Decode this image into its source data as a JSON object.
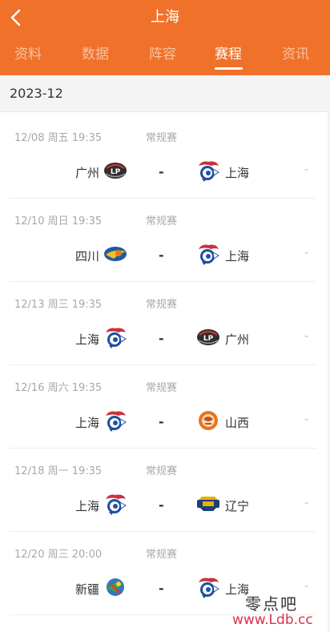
{
  "header": {
    "title": "上海",
    "back_icon": "chevron-left-icon"
  },
  "tabs": [
    {
      "label": "资料",
      "active": false
    },
    {
      "label": "数据",
      "active": false
    },
    {
      "label": "阵容",
      "active": false
    },
    {
      "label": "赛程",
      "active": true
    },
    {
      "label": "资讯",
      "active": false
    }
  ],
  "month": "2023-12",
  "games": [
    {
      "date": "12/08  周五  19:35",
      "type": "常规赛",
      "home": "广州",
      "home_logo": "guangzhou-logo-icon",
      "vs": "-",
      "away": "上海",
      "away_logo": "shanghai-logo-icon",
      "score": "-"
    },
    {
      "date": "12/10  周日  19:35",
      "type": "常规赛",
      "home": "四川",
      "home_logo": "sichuan-logo-icon",
      "vs": "-",
      "away": "上海",
      "away_logo": "shanghai-logo-icon",
      "score": "-"
    },
    {
      "date": "12/13  周三  19:35",
      "type": "常规赛",
      "home": "上海",
      "home_logo": "shanghai-logo-icon",
      "vs": "-",
      "away": "广州",
      "away_logo": "guangzhou-logo-icon",
      "score": "-"
    },
    {
      "date": "12/16  周六  19:35",
      "type": "常规赛",
      "home": "上海",
      "home_logo": "shanghai-logo-icon",
      "vs": "-",
      "away": "山西",
      "away_logo": "shanxi-logo-icon",
      "score": "-"
    },
    {
      "date": "12/18  周一  19:35",
      "type": "常规赛",
      "home": "上海",
      "home_logo": "shanghai-logo-icon",
      "vs": "-",
      "away": "辽宁",
      "away_logo": "liaoning-logo-icon",
      "score": "-"
    },
    {
      "date": "12/20  周三  20:00",
      "type": "常规赛",
      "home": "新疆",
      "home_logo": "xinjiang-logo-icon",
      "vs": "-",
      "away": "上海",
      "away_logo": "shanghai-logo-icon",
      "score": "-"
    }
  ],
  "watermark": {
    "cn": "零点吧",
    "url": "www.Ldb.cc"
  },
  "colors": {
    "accent": "#f0712a",
    "text": "#333333",
    "muted": "#a8a8a8"
  }
}
